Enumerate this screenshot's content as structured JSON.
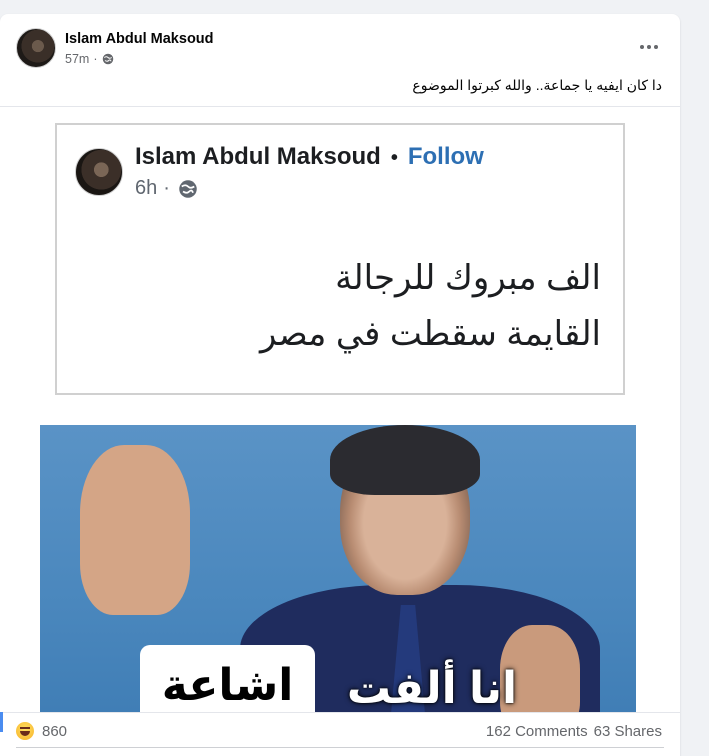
{
  "post": {
    "author": "Islam Abdul Maksoud",
    "time": "57m",
    "caption": "دا كان ايفيه يا جماعة.. والله كبرتوا الموضوع"
  },
  "screenshot": {
    "author": "Islam Abdul Maksoud",
    "follow": "Follow",
    "time": "6h",
    "line1": "الف مبروك للرجالة",
    "line2": "القايمة سقطت في مصر"
  },
  "meme": {
    "left_text": "اشاعة",
    "right_text": "انا ألفت"
  },
  "footer": {
    "reaction_count": "860",
    "comments": "162 Comments",
    "shares": "63 Shares"
  },
  "icons": {
    "menu": "more-options-icon",
    "privacy": "globe-icon",
    "reaction": "haha-icon"
  },
  "colors": {
    "follow_blue": "#2d6fb3",
    "card_bg": "#ffffff",
    "page_bg": "#f0f2f5"
  }
}
